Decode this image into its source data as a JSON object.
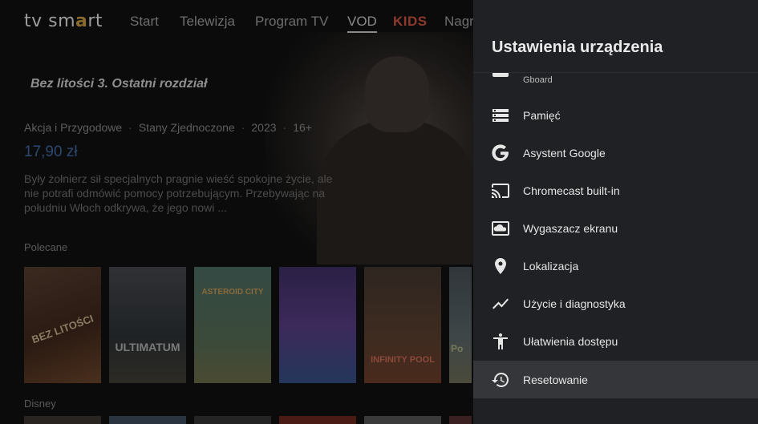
{
  "app": {
    "logo": {
      "part1": "tv sm",
      "accent": "a",
      "part2": "rt"
    },
    "nav": [
      {
        "label": "Start"
      },
      {
        "label": "Telewizja"
      },
      {
        "label": "Program TV"
      },
      {
        "label": "VOD"
      },
      {
        "label": "KIDS"
      },
      {
        "label": "Nagr"
      }
    ],
    "movie": {
      "title": "Bez litości 3. Ostatni rozdział",
      "genre": "Akcja i Przygodowe",
      "country": "Stany Zjednoczone",
      "year": "2023",
      "rating": "16+",
      "price": "17,90 zł",
      "description": "Były żołnierz sił specjalnych pragnie wieść spokojne życie, ale nie potrafi odmówić pomocy potrzebującym. Przebywając na południu Włoch odkrywa, że jego nowi ..."
    },
    "sections": {
      "recommended": "Polecane",
      "disney": "Disney"
    },
    "posters": [
      {
        "title": "BEZ LITOŚCI"
      },
      {
        "title": "ULTIMATUM"
      },
      {
        "title": "ASTEROID CITY"
      },
      {
        "title": ""
      },
      {
        "title": "INFINITY POOL"
      },
      {
        "title": "Po"
      }
    ]
  },
  "panel": {
    "title": "Ustawienia urządzenia",
    "items": [
      {
        "label": "",
        "sublabel": "Gboard",
        "icon": "keyboard-icon"
      },
      {
        "label": "Pamięć",
        "icon": "storage-icon"
      },
      {
        "label": "Asystent Google",
        "icon": "google-icon"
      },
      {
        "label": "Chromecast built-in",
        "icon": "cast-icon"
      },
      {
        "label": "Wygaszacz ekranu",
        "icon": "screensaver-icon"
      },
      {
        "label": "Lokalizacja",
        "icon": "location-pin-icon"
      },
      {
        "label": "Użycie i diagnostyka",
        "icon": "trending-line-icon"
      },
      {
        "label": "Ułatwienia dostępu",
        "icon": "accessibility-icon"
      },
      {
        "label": "Resetowanie",
        "icon": "history-icon"
      }
    ],
    "focused_item": "Resetowanie"
  }
}
